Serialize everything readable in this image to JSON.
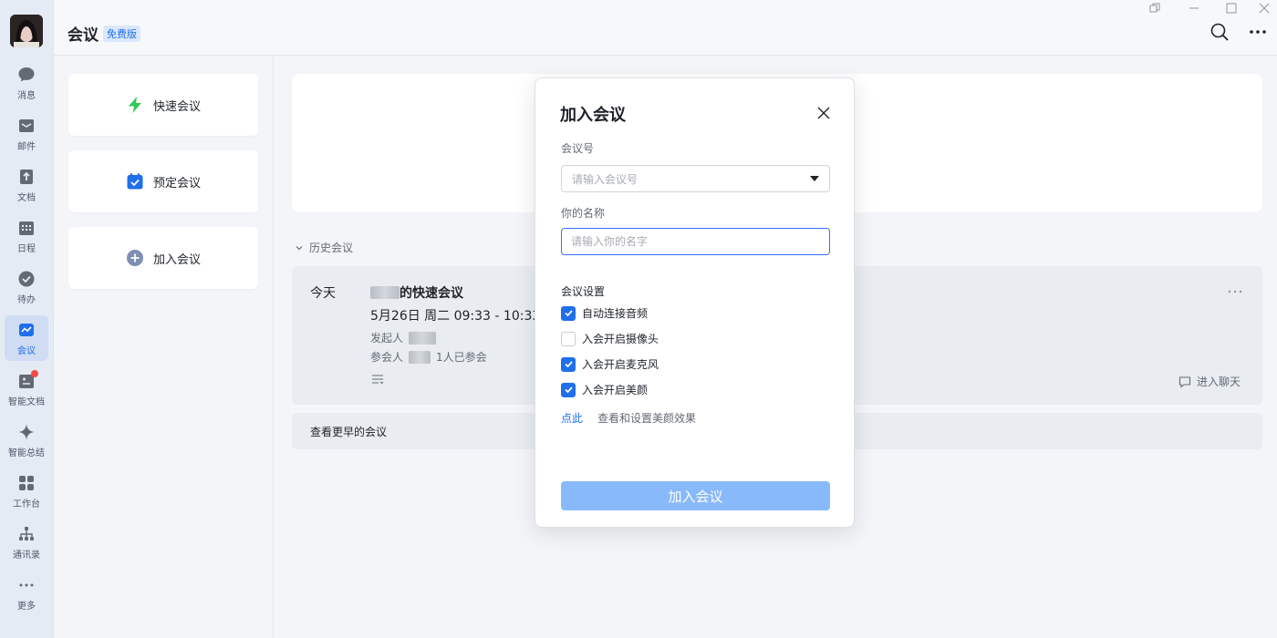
{
  "nav": {
    "items": [
      {
        "label": "消息",
        "icon": "message-icon"
      },
      {
        "label": "邮件",
        "icon": "mail-icon"
      },
      {
        "label": "文档",
        "icon": "docs-icon"
      },
      {
        "label": "日程",
        "icon": "calendar-icon"
      },
      {
        "label": "待办",
        "icon": "todo-icon"
      },
      {
        "label": "会议",
        "icon": "meeting-icon",
        "active": true
      },
      {
        "label": "智能文档",
        "icon": "smart-docs-icon",
        "has_badge": true
      },
      {
        "label": "智能总结",
        "icon": "smart-summary-icon"
      },
      {
        "label": "工作台",
        "icon": "workbench-icon"
      },
      {
        "label": "通讯录",
        "icon": "contacts-icon"
      },
      {
        "label": "更多",
        "icon": "more-icon"
      }
    ]
  },
  "header": {
    "title": "会议",
    "badge": "免费版"
  },
  "actions": {
    "quick": "快速会议",
    "schedule": "预定会议",
    "join": "加入会议"
  },
  "history": {
    "title": "历史会议",
    "meeting": {
      "day": "今天",
      "title_suffix": "的快速会议",
      "time": "5月26日 周二 09:33 - 10:33",
      "organizer_label": "发起人",
      "participants_label": "参会人",
      "participants_count": "1人已参会",
      "chat_label": "进入聊天"
    },
    "earlier": "查看更早的会议"
  },
  "modal": {
    "title": "加入会议",
    "meeting_id_label": "会议号",
    "meeting_id_placeholder": "请输入会议号",
    "name_label": "你的名称",
    "name_placeholder": "请输入你的名字",
    "settings_title": "会议设置",
    "options": [
      {
        "label": "自动连接音频",
        "checked": true
      },
      {
        "label": "入会开启摄像头",
        "checked": false
      },
      {
        "label": "入会开启麦克风",
        "checked": true
      },
      {
        "label": "入会开启美颜",
        "checked": true
      }
    ],
    "beauty_link": "点此",
    "beauty_desc": "查看和设置美颜效果",
    "join_button": "加入会议"
  },
  "colors": {
    "accent": "#1f6feb",
    "join_disabled": "#88b9fb",
    "quick_icon": "#34c759"
  }
}
